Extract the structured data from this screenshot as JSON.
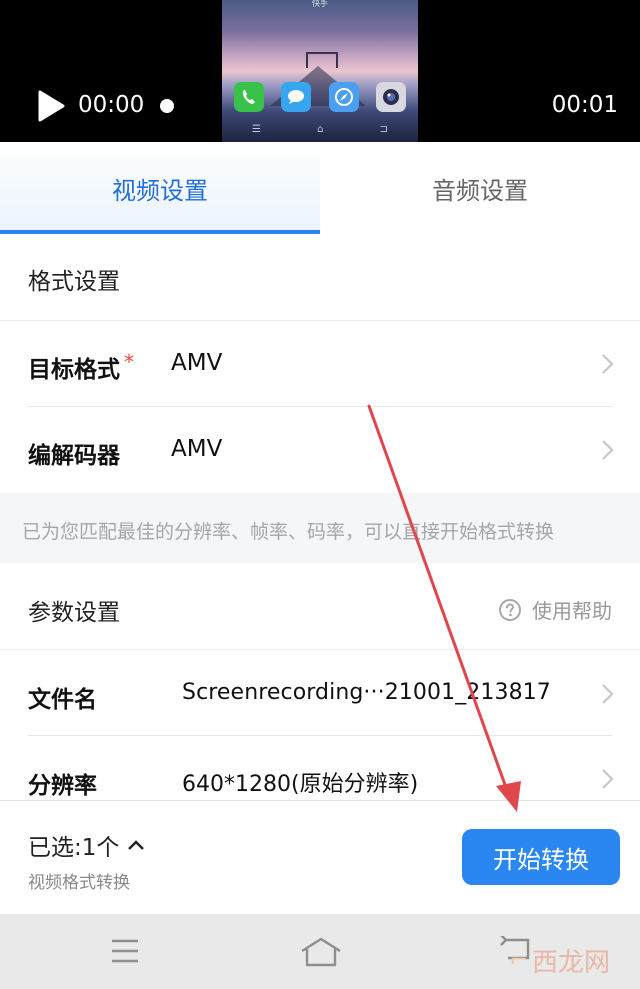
{
  "player": {
    "current_time": "00:00",
    "duration": "00:01",
    "preview_label": "快手"
  },
  "tabs": [
    {
      "label": "视频设置",
      "active": true
    },
    {
      "label": "音频设置",
      "active": false
    }
  ],
  "format_section": {
    "title": "格式设置",
    "target_format_label": "目标格式",
    "required_mark": "*",
    "target_format_value": "AMV",
    "codec_label": "编解码器",
    "codec_value": "AMV",
    "hint": "已为您匹配最佳的分辨率、帧率、码率，可以直接开始格式转换"
  },
  "param_section": {
    "title": "参数设置",
    "help_label": "使用帮助",
    "filename_label": "文件名",
    "filename_value": "Screenrecording···21001_213817",
    "resolution_label": "分辨率",
    "resolution_value": "640*1280(原始分辨率)"
  },
  "bottom_bar": {
    "selected_label": "已选:1个",
    "selected_sub": "视频格式转换",
    "start_button": "开始转换"
  },
  "watermark": {
    "text": "西龙网"
  },
  "colors": {
    "accent": "#2a86f0",
    "active_tab_text": "#1f6ed9",
    "required": "#e84c3d",
    "annotation_arrow": "#e0474c"
  },
  "icons": [
    "play-icon",
    "scrub-dot",
    "chevron-right-icon",
    "help-circle-icon",
    "chevron-up-icon",
    "menu-icon",
    "home-icon",
    "back-icon"
  ]
}
